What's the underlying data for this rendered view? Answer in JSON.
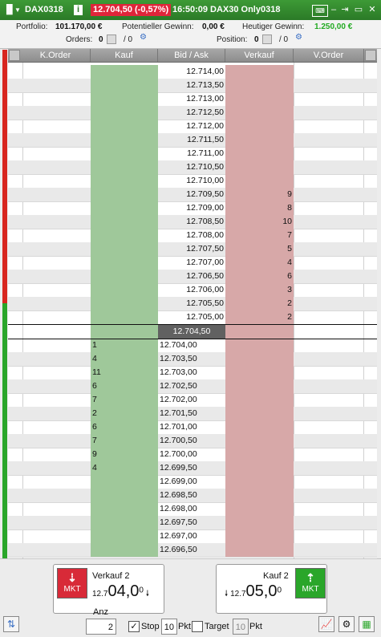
{
  "titlebar": {
    "symbol": "DAX0318",
    "price_change": "12.704,50 (-0,57%)",
    "time": "16:50:09",
    "account": "DAX30 Only0318"
  },
  "info": {
    "portfolio_label": "Portfolio:",
    "portfolio_value": "101.170,00 €",
    "pot_gain_label": "Potentieller Gewinn:",
    "pot_gain_value": "0,00 €",
    "today_gain_label": "Heutiger Gewinn:",
    "today_gain_value": "1.250,00 €",
    "orders_label": "Orders:",
    "orders_value": "0",
    "orders_slash": "/ 0",
    "position_label": "Position:",
    "position_value": "0",
    "position_slash": "/ 0"
  },
  "columns": {
    "korder": "K.Order",
    "kauf": "Kauf",
    "bidask": "Bid / Ask",
    "verkauf": "Verkauf",
    "vorder": "V.Order"
  },
  "ask_rows": [
    {
      "price": "12.714,00",
      "qty": ""
    },
    {
      "price": "12.713,50",
      "qty": ""
    },
    {
      "price": "12.713,00",
      "qty": ""
    },
    {
      "price": "12.712,50",
      "qty": ""
    },
    {
      "price": "12.712,00",
      "qty": ""
    },
    {
      "price": "12.711,50",
      "qty": ""
    },
    {
      "price": "12.711,00",
      "qty": ""
    },
    {
      "price": "12.710,50",
      "qty": ""
    },
    {
      "price": "12.710,00",
      "qty": ""
    },
    {
      "price": "12.709,50",
      "qty": "9"
    },
    {
      "price": "12.709,00",
      "qty": "8"
    },
    {
      "price": "12.708,50",
      "qty": "10"
    },
    {
      "price": "12.708,00",
      "qty": "7"
    },
    {
      "price": "12.707,50",
      "qty": "5"
    },
    {
      "price": "12.707,00",
      "qty": "4"
    },
    {
      "price": "12.706,50",
      "qty": "6"
    },
    {
      "price": "12.706,00",
      "qty": "3"
    },
    {
      "price": "12.705,50",
      "qty": "2"
    },
    {
      "price": "12.705,00",
      "qty": "2"
    }
  ],
  "current_price": "12.704,50",
  "bid_rows": [
    {
      "price": "12.704,00",
      "qty": "1"
    },
    {
      "price": "12.703,50",
      "qty": "4"
    },
    {
      "price": "12.703,00",
      "qty": "11"
    },
    {
      "price": "12.702,50",
      "qty": "6"
    },
    {
      "price": "12.702,00",
      "qty": "7"
    },
    {
      "price": "12.701,50",
      "qty": "2"
    },
    {
      "price": "12.701,00",
      "qty": "6"
    },
    {
      "price": "12.700,50",
      "qty": "7"
    },
    {
      "price": "12.700,00",
      "qty": "9"
    },
    {
      "price": "12.699,50",
      "qty": "4"
    },
    {
      "price": "12.699,00",
      "qty": ""
    },
    {
      "price": "12.698,50",
      "qty": ""
    },
    {
      "price": "12.698,00",
      "qty": ""
    },
    {
      "price": "12.697,50",
      "qty": ""
    },
    {
      "price": "12.697,00",
      "qty": ""
    },
    {
      "price": "12.696,50",
      "qty": ""
    }
  ],
  "sell_button": {
    "label": "Verkauf 2",
    "price_prefix": "12.7",
    "price_main": "04,0",
    "price_sup": "0",
    "mkt": "MKT"
  },
  "buy_button": {
    "label": "Kauf 2",
    "price_prefix": "12.7",
    "price_main": "05,0",
    "price_sup": "0",
    "mkt": "MKT"
  },
  "controls": {
    "anz_label": "Anz",
    "anz_value": "2",
    "stop_label": "Stop",
    "stop_value": "10",
    "stop_unit": "Pkt",
    "target_label": "Target",
    "target_value": "10",
    "target_unit": "Pkt"
  },
  "colors": {
    "buy": "#9fc89a",
    "sell": "#d7a8a8",
    "titlebar": "#2b7a27",
    "badge": "#e0253a"
  }
}
